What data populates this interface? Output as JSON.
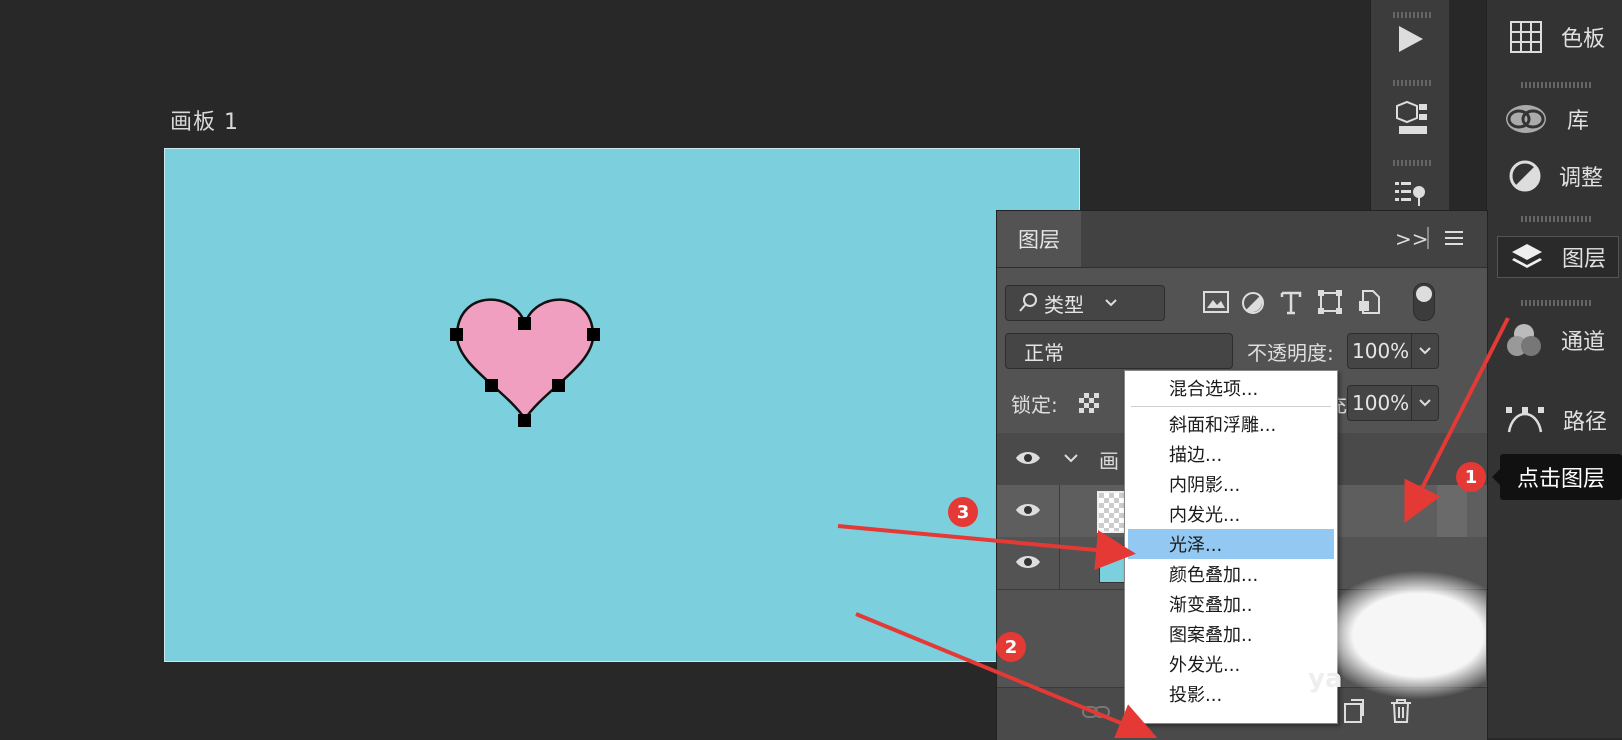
{
  "artboard": {
    "title": "画板 1",
    "background": "#7ccfdc",
    "heart_fill": "#f19fc1"
  },
  "right_dock": {
    "items": [
      {
        "icon": "swatches-icon",
        "label": "色板"
      },
      {
        "icon": "libraries-icon",
        "label": "库"
      },
      {
        "icon": "adjustments-icon",
        "label": "调整"
      },
      {
        "icon": "layers-icon",
        "label": "图层"
      },
      {
        "icon": "channels-icon",
        "label": "通道"
      },
      {
        "icon": "paths-icon",
        "label": "路径"
      }
    ],
    "col1_icons": [
      "play-icon",
      "3d-cube-icon",
      "properties-icon"
    ]
  },
  "layers_panel": {
    "tab": "图层",
    "expand_glyph": ">>",
    "filter": {
      "label": "类型"
    },
    "blend_mode": "正常",
    "opacity_label": "不透明度:",
    "opacity_value": "100%",
    "lock_label": "锁定:",
    "fill_label_partial": "充:",
    "fill_value": "100%",
    "artboard_row_label": "画"
  },
  "context_menu": {
    "items": [
      "混合选项...",
      "斜面和浮雕...",
      "描边...",
      "内阴影...",
      "内发光...",
      "光泽...",
      "颜色叠加...",
      "渐变叠加..",
      "图案叠加..",
      "外发光...",
      "投影..."
    ],
    "selected_index": 5
  },
  "annotations": {
    "badges": [
      "1",
      "2",
      "3"
    ],
    "tooltip": "点击图层",
    "accent": "#e53935"
  },
  "watermark_partial": "ya"
}
